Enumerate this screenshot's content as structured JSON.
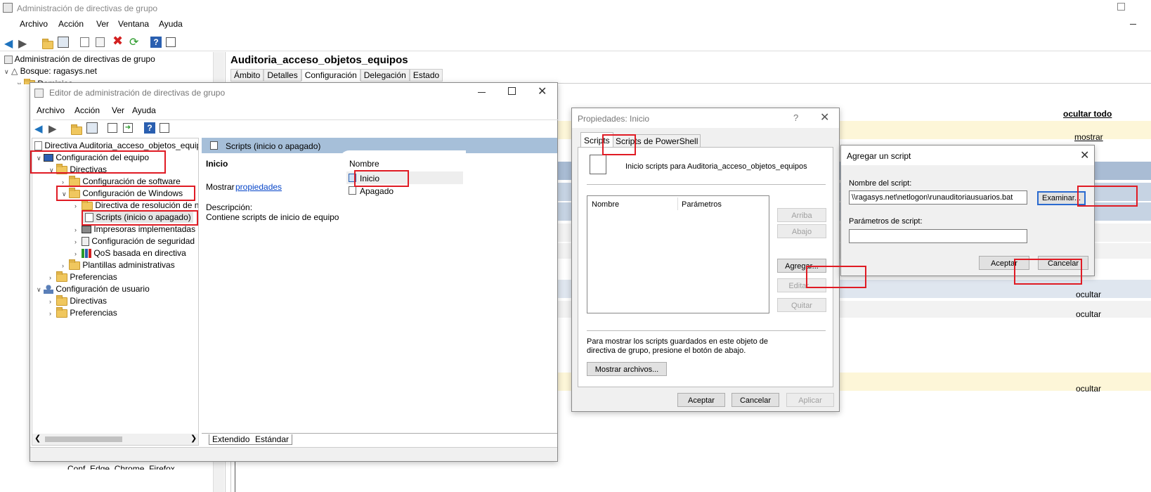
{
  "main_window": {
    "title": "Administración de directivas de grupo",
    "menu": [
      "Archivo",
      "Acción",
      "Ver",
      "Ventana",
      "Ayuda"
    ],
    "tree": {
      "root": "Administración de directivas de grupo",
      "forest": "Bosque: ragasys.net",
      "domains": "Dominios",
      "bottom_item": "Conf_Edge_Chrome_Firefox"
    },
    "gpo_title": "Auditoria_acceso_objetos_equipos",
    "tabs": [
      "Ámbito",
      "Detalles",
      "Configuración",
      "Delegación",
      "Estado"
    ],
    "hide_all": "ocultar todo",
    "show": "mostrar",
    "hide": [
      "ocultar",
      "ocultar",
      "ocultar"
    ]
  },
  "editor": {
    "title": "Editor de administración de directivas de grupo",
    "menu": [
      "Archivo",
      "Acción",
      "Ver",
      "Ayuda"
    ],
    "tree": {
      "root": "Directiva Auditoria_acceso_objetos_equipos",
      "computer_config": "Configuración del equipo",
      "policies": "Directivas",
      "software": "Configuración de software",
      "windows": "Configuración de Windows",
      "name_resolution": "Directiva de resolución de n",
      "scripts": "Scripts (inicio o apagado)",
      "printers": "Impresoras implementadas",
      "security": "Configuración de seguridad",
      "qos": "QoS basada en directiva",
      "admin_templates": "Plantillas administrativas",
      "preferences": "Preferencias",
      "user_config": "Configuración de usuario",
      "user_policies": "Directivas",
      "user_preferences": "Preferencias"
    },
    "detail_header": "Scripts (inicio o apagado)",
    "detail_item": "Inicio",
    "show_label": "Mostrar",
    "properties_link": "propiedades",
    "description_label": "Descripción:",
    "description_text": "Contiene scripts de inicio de equipo.",
    "list_header": "Nombre",
    "list_items": [
      "Inicio",
      "Apagado"
    ],
    "bottom_tabs": [
      "Extendido",
      "Estándar"
    ]
  },
  "props_dialog": {
    "title": "Propiedades: Inicio",
    "help": "?",
    "tabs": [
      "Scripts",
      "Scripts de PowerShell"
    ],
    "heading": "Inicio scripts para Auditoria_acceso_objetos_equipos",
    "col_name": "Nombre",
    "col_params": "Parámetros",
    "btn_up": "Arriba",
    "btn_down": "Abajo",
    "btn_add": "Agregar...",
    "btn_edit": "Editar...",
    "btn_remove": "Quitar",
    "info": "Para mostrar los scripts guardados en este objeto de directiva de grupo, presione el botón de abajo.",
    "btn_show_files": "Mostrar archivos...",
    "btn_ok": "Aceptar",
    "btn_cancel": "Cancelar",
    "btn_apply": "Aplicar"
  },
  "add_dialog": {
    "title": "Agregar un script",
    "name_label": "Nombre del script:",
    "name_value": "\\\\ragasys.net\\netlogon\\runauditoriausuarios.bat",
    "browse": "Examinar...",
    "params_label": "Parámetros de script:",
    "params_value": "",
    "btn_ok": "Aceptar",
    "btn_cancel": "Cancelar"
  },
  "colors": {
    "highlight": "#e01b24",
    "selection": "#cce8ff",
    "header_blue": "#a6bfd9",
    "link": "#0645c8"
  }
}
